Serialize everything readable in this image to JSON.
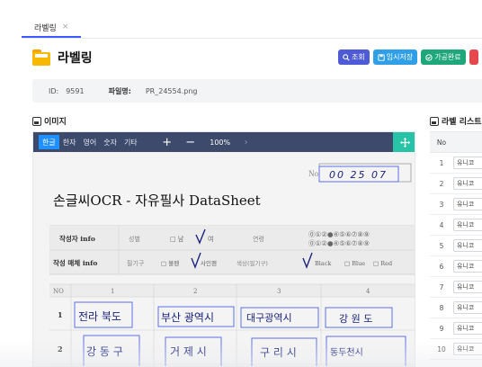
{
  "tab": {
    "label": "라벨링",
    "close": "×"
  },
  "page": {
    "title": "라벨링"
  },
  "actions": [
    {
      "label": "조회",
      "icon": "search-icon",
      "color": "#4f5bd5"
    },
    {
      "label": "임시저장",
      "icon": "save-icon",
      "color": "#2f9fe8"
    },
    {
      "label": "가공완료",
      "icon": "check-circle-icon",
      "color": "#1fa67a"
    },
    {
      "label": "",
      "icon": "",
      "color": "#e5484d"
    }
  ],
  "info": {
    "id_label": "ID:",
    "id_value": "9591",
    "file_label": "파일명:",
    "file_value": "PR_24554.png"
  },
  "image_section": {
    "title": "이미지"
  },
  "viewer": {
    "langs": [
      "한글",
      "한자",
      "영어",
      "숫자",
      "기타"
    ],
    "active_lang": "한글",
    "zoom_in": "+",
    "zoom_out": "−",
    "zoom": "100%",
    "next": "›",
    "move_icon": "move-icon"
  },
  "document": {
    "no_label": "No",
    "no_value": "00 25 07",
    "title": "손글씨OCR - 자유필사 DataSheet",
    "row1": {
      "label": "작성자 info",
      "gender_label": "성별",
      "male": "□ 남",
      "female": "여",
      "age_label": "연령",
      "digits_top": "⓪①②●④⑤⑥⑦⑧⑨",
      "digits_bottom": "⓪①②●④⑤⑥⑦⑧⑨"
    },
    "row2": {
      "label": "작성 매체 info",
      "tool_label": "필기구",
      "pen": "□ 볼펜",
      "sign": "사인펜",
      "color_label": "색상(필기구)",
      "black": "Black",
      "blue": "□ Blue",
      "red": "□ Red"
    },
    "grid_header": [
      "NO",
      "1",
      "2",
      "3",
      "4"
    ],
    "grid_rows": [
      {
        "no": "1",
        "cells": [
          "전라 북도",
          "부산 광역시",
          "대구광역시",
          "강 원 도"
        ]
      },
      {
        "no": "2",
        "cells": [
          "강 동 구",
          "거 제 시",
          "구 리 시",
          "동두천시"
        ]
      }
    ]
  },
  "label_list": {
    "title": "라벨 리스트",
    "header_no": "No",
    "rows": [
      {
        "no": "1",
        "value": "유니코"
      },
      {
        "no": "2",
        "value": "유니코"
      },
      {
        "no": "3",
        "value": "유니코"
      },
      {
        "no": "4",
        "value": "유니코"
      },
      {
        "no": "5",
        "value": "유니코"
      },
      {
        "no": "6",
        "value": "유니코"
      },
      {
        "no": "7",
        "value": "유니코"
      },
      {
        "no": "8",
        "value": "유니코"
      },
      {
        "no": "9",
        "value": "유니코"
      },
      {
        "no": "10",
        "value": "유니코"
      }
    ]
  },
  "colors": {
    "accent": "#3d5afe",
    "toolbar": "#3e4a6b",
    "active_lang": "#1e90ff",
    "move": "#27c3a6",
    "bbox": "#5b6fe6"
  }
}
